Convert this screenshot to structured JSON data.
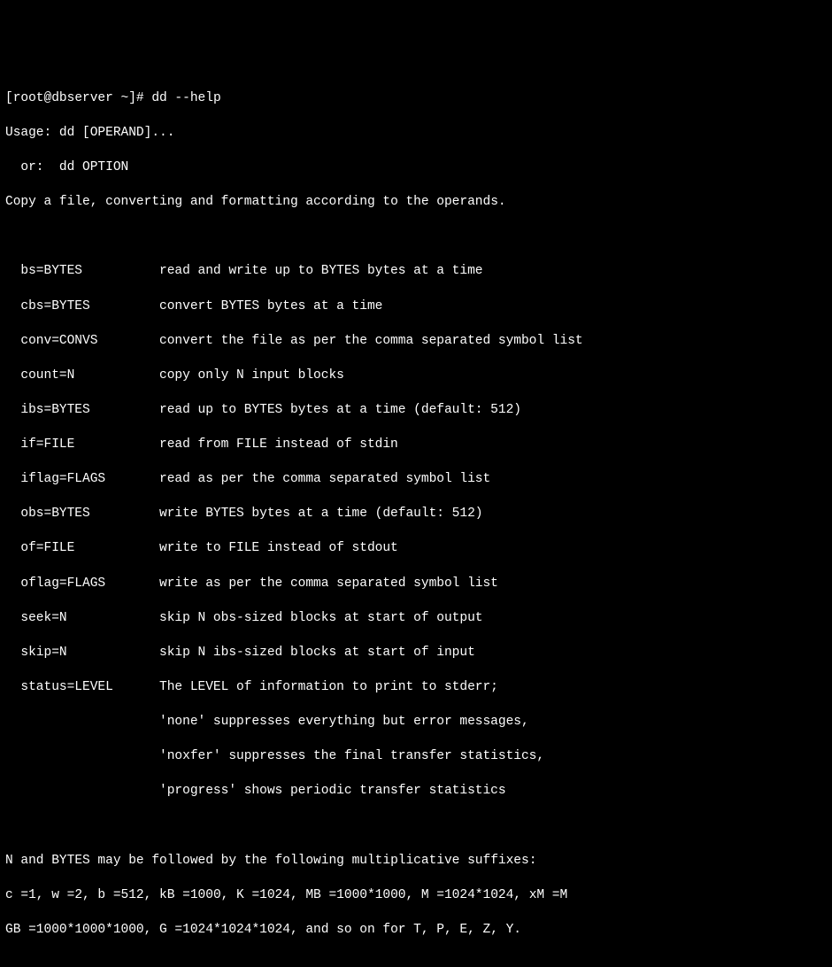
{
  "prompt": {
    "userhost": "[root@dbserver ~]# ",
    "command": "dd --help"
  },
  "usage": {
    "line1": "Usage: dd [OPERAND]...",
    "line2": "  or:  dd OPTION",
    "desc": "Copy a file, converting and formatting according to the operands."
  },
  "operands": [
    {
      "opt": "bs=BYTES",
      "desc": "read and write up to BYTES bytes at a time"
    },
    {
      "opt": "cbs=BYTES",
      "desc": "convert BYTES bytes at a time"
    },
    {
      "opt": "conv=CONVS",
      "desc": "convert the file as per the comma separated symbol list"
    },
    {
      "opt": "count=N",
      "desc": "copy only N input blocks"
    },
    {
      "opt": "ibs=BYTES",
      "desc": "read up to BYTES bytes at a time (default: 512)"
    },
    {
      "opt": "if=FILE",
      "desc": "read from FILE instead of stdin"
    },
    {
      "opt": "iflag=FLAGS",
      "desc": "read as per the comma separated symbol list"
    },
    {
      "opt": "obs=BYTES",
      "desc": "write BYTES bytes at a time (default: 512)"
    },
    {
      "opt": "of=FILE",
      "desc": "write to FILE instead of stdout"
    },
    {
      "opt": "oflag=FLAGS",
      "desc": "write as per the comma separated symbol list"
    },
    {
      "opt": "seek=N",
      "desc": "skip N obs-sized blocks at start of output"
    },
    {
      "opt": "skip=N",
      "desc": "skip N ibs-sized blocks at start of input"
    },
    {
      "opt": "status=LEVEL",
      "desc": "The LEVEL of information to print to stderr;"
    }
  ],
  "status_extra": [
    "'none' suppresses everything but error messages,",
    "'noxfer' suppresses the final transfer statistics,",
    "'progress' shows periodic transfer statistics"
  ],
  "suffixes": {
    "line1": "N and BYTES may be followed by the following multiplicative suffixes:",
    "line2": "c =1, w =2, b =512, kB =1000, K =1024, MB =1000*1000, M =1024*1024, xM =M",
    "line3": "GB =1000*1000*1000, G =1024*1024*1024, and so on for T, P, E, Z, Y."
  }
}
